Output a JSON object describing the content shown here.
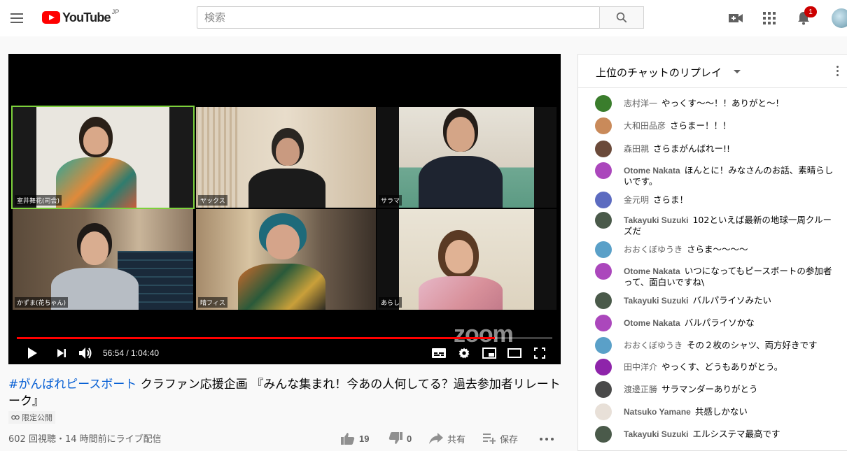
{
  "header": {
    "logo_text": "YouTube",
    "logo_region": "JP",
    "search_placeholder": "検索",
    "notification_count": "1"
  },
  "player": {
    "progress_fraction": 0.893,
    "time_current": "56:54",
    "time_total": "1:04:40",
    "watermark": "zoom",
    "participants": [
      {
        "name": "室井舞花(司会)"
      },
      {
        "name": "ヤックス"
      },
      {
        "name": "サラマ"
      },
      {
        "name": "かずま(花ちゃん)"
      },
      {
        "name": "晴フィス"
      },
      {
        "name": "あらし"
      }
    ]
  },
  "video": {
    "title_tag": "#がんばれピースボート",
    "title_rest": " クラファン応援企画 『みんな集まれ！今あの人何してる？過去参加者リレートーク』",
    "visibility": "限定公開",
    "stats": "602 回視聴・14 時間前にライブ配信",
    "likes": "19",
    "dislikes": "0",
    "share_label": "共有",
    "save_label": "保存"
  },
  "chat": {
    "title": "上位のチャットのリプレイ",
    "messages": [
      {
        "author": "志村洋一",
        "text": "やっくす〜〜！！ありがと〜！",
        "color": "#3a7d2c"
      },
      {
        "author": "大和田品彦",
        "text": "さらまー！！！",
        "color": "#c98a5a"
      },
      {
        "author": "森田親",
        "text": "さらまがんばれー!!",
        "color": "#6b4a3a"
      },
      {
        "author": "Otome Nakata",
        "text": "ほんとに！みなさんのお話、素晴らしいです。",
        "color": "#ab47bc"
      },
      {
        "author": "金元明",
        "text": "さらま！",
        "color": "#5c6bc0"
      },
      {
        "author": "Takayuki Suzuki",
        "text": "102といえば最新の地球一周クルーズだ",
        "color": "#4a5a4a"
      },
      {
        "author": "おおくぼゆうき",
        "text": "さらま〜〜〜〜",
        "color": "#5aa0c8"
      },
      {
        "author": "Otome Nakata",
        "text": "いつになってもピースボートの参加者って、面白いですね\\",
        "color": "#ab47bc"
      },
      {
        "author": "Takayuki Suzuki",
        "text": "バルパライソみたい",
        "color": "#4a5a4a"
      },
      {
        "author": "Otome Nakata",
        "text": "バルパライソかな",
        "color": "#ab47bc"
      },
      {
        "author": "おおくぼゆうき",
        "text": "その２枚のシャツ、両方好きです",
        "color": "#5aa0c8"
      },
      {
        "author": "田中洋介",
        "text": "やっくす、どうもありがとう。",
        "color": "#8e24aa"
      },
      {
        "author": "渡邊正勝",
        "text": "サラマンダーありがとう",
        "color": "#4a4a4a"
      },
      {
        "author": "Natsuko Yamane",
        "text": "共感しかない",
        "color": "#e8e0d8"
      },
      {
        "author": "Takayuki Suzuki",
        "text": "エルシステマ最高です",
        "color": "#4a5a4a"
      }
    ]
  }
}
